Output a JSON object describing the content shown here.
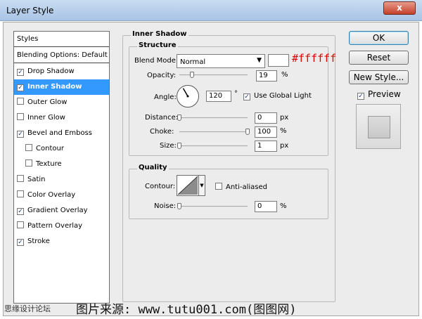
{
  "window": {
    "title": "Layer Style",
    "close_label": "x"
  },
  "sidebar": {
    "items": [
      {
        "label": "Styles",
        "checkbox": false
      },
      {
        "label": "Blending Options: Default",
        "checkbox": false
      },
      {
        "label": "Drop Shadow",
        "checkbox": true,
        "checked": true
      },
      {
        "label": "Inner Shadow",
        "checkbox": true,
        "checked": true,
        "selected": true
      },
      {
        "label": "Outer Glow",
        "checkbox": true,
        "checked": false
      },
      {
        "label": "Inner Glow",
        "checkbox": true,
        "checked": false
      },
      {
        "label": "Bevel and Emboss",
        "checkbox": true,
        "checked": true
      },
      {
        "label": "Contour",
        "checkbox": true,
        "checked": false,
        "indent": true
      },
      {
        "label": "Texture",
        "checkbox": true,
        "checked": false,
        "indent": true
      },
      {
        "label": "Satin",
        "checkbox": true,
        "checked": false
      },
      {
        "label": "Color Overlay",
        "checkbox": true,
        "checked": false
      },
      {
        "label": "Gradient Overlay",
        "checkbox": true,
        "checked": true
      },
      {
        "label": "Pattern Overlay",
        "checkbox": true,
        "checked": false
      },
      {
        "label": "Stroke",
        "checkbox": true,
        "checked": true
      }
    ]
  },
  "inner_shadow": {
    "section_title": "Inner Shadow",
    "structure": {
      "title": "Structure",
      "blend_mode_label": "Blend Mode:",
      "blend_mode_value": "Normal",
      "color_hex": "#ffffff",
      "color_annotation": "#ffffff",
      "opacity_label": "Opacity:",
      "opacity_value": "19",
      "opacity_percent": 19,
      "opacity_unit": "%",
      "angle_label": "Angle:",
      "angle_value": "120",
      "angle_degrees": 120,
      "angle_unit": "°",
      "use_global_light_label": "Use Global Light",
      "use_global_light_checked": true,
      "distance_label": "Distance:",
      "distance_value": "0",
      "distance_unit": "px",
      "distance_fraction": 0,
      "choke_label": "Choke:",
      "choke_value": "100",
      "choke_unit": "%",
      "choke_fraction": 1,
      "size_label": "Size:",
      "size_value": "1",
      "size_unit": "px",
      "size_fraction": 0.004
    },
    "quality": {
      "title": "Quality",
      "contour_label": "Contour:",
      "anti_aliased_label": "Anti-aliased",
      "anti_aliased_checked": false,
      "noise_label": "Noise:",
      "noise_value": "0",
      "noise_unit": "%",
      "noise_fraction": 0
    }
  },
  "buttons": {
    "ok": "OK",
    "reset": "Reset",
    "new_style": "New Style...",
    "preview_label": "Preview",
    "preview_checked": true
  },
  "watermark": {
    "left": "思缘设计论坛",
    "main": "图片来源: www.tutu001.com(图图网)"
  }
}
